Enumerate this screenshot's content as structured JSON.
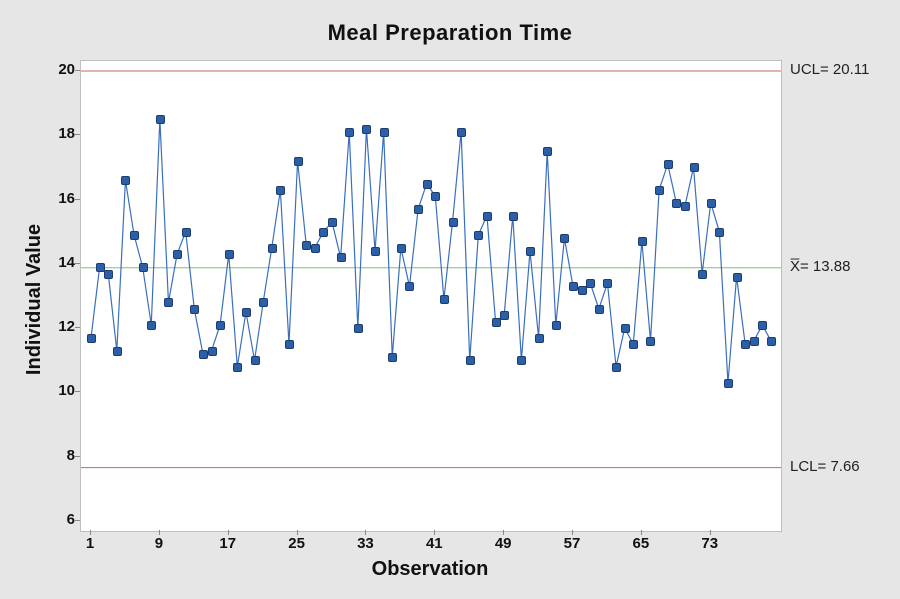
{
  "chart_data": {
    "type": "line",
    "title": "Meal Preparation Time",
    "xlabel": "Observation",
    "ylabel": "Individual Value",
    "ylim": [
      6,
      20
    ],
    "xlim": [
      1,
      80
    ],
    "yticks": [
      6,
      8,
      10,
      12,
      14,
      16,
      18,
      20
    ],
    "xticks": [
      1,
      9,
      17,
      25,
      33,
      41,
      49,
      57,
      65,
      73
    ],
    "ref_lines": [
      {
        "name": "UCL",
        "value": 20.11,
        "label": "UCL= 20.11",
        "color": "#c76a5d"
      },
      {
        "name": "Xbar",
        "value": 13.88,
        "label": "X̅= 13.88",
        "color": "#7fbf7f"
      },
      {
        "name": "LCL",
        "value": 7.66,
        "label": "LCL= 7.66",
        "color": "#c76a5d"
      }
    ],
    "series": [
      {
        "name": "Individual Value",
        "color": "#3a6fbf",
        "x": [
          1,
          2,
          3,
          4,
          5,
          6,
          7,
          8,
          9,
          10,
          11,
          12,
          13,
          14,
          15,
          16,
          17,
          18,
          19,
          20,
          21,
          22,
          23,
          24,
          25,
          26,
          27,
          28,
          29,
          30,
          31,
          32,
          33,
          34,
          35,
          36,
          37,
          38,
          39,
          40,
          41,
          42,
          43,
          44,
          45,
          46,
          47,
          48,
          49,
          50,
          51,
          52,
          53,
          54,
          55,
          56,
          57,
          58,
          59,
          60,
          61,
          62,
          63,
          64,
          65,
          66,
          67,
          68,
          69,
          70,
          71,
          72,
          73,
          74,
          75,
          76,
          77,
          78,
          79,
          80
        ],
        "values": [
          11.7,
          13.9,
          13.7,
          11.3,
          16.6,
          14.9,
          13.9,
          12.1,
          18.5,
          12.8,
          14.3,
          15.0,
          12.6,
          11.2,
          11.3,
          12.1,
          14.3,
          10.8,
          12.5,
          11.0,
          12.8,
          14.5,
          16.3,
          11.5,
          17.2,
          14.6,
          14.5,
          15.0,
          15.3,
          14.2,
          18.1,
          12.0,
          18.2,
          14.4,
          18.1,
          11.1,
          14.5,
          13.3,
          15.7,
          16.5,
          16.1,
          12.9,
          15.3,
          18.1,
          11.0,
          14.9,
          15.5,
          12.2,
          12.4,
          15.5,
          11.0,
          14.4,
          11.7,
          17.5,
          12.1,
          14.8,
          13.3,
          13.2,
          13.4,
          12.6,
          13.4,
          10.8,
          12.0,
          11.5,
          14.7,
          11.6,
          16.3,
          17.1,
          15.9,
          15.8,
          17.0,
          13.7,
          15.9,
          15.0,
          10.3,
          13.6,
          11.5,
          11.6,
          12.1,
          11.6
        ]
      }
    ]
  }
}
